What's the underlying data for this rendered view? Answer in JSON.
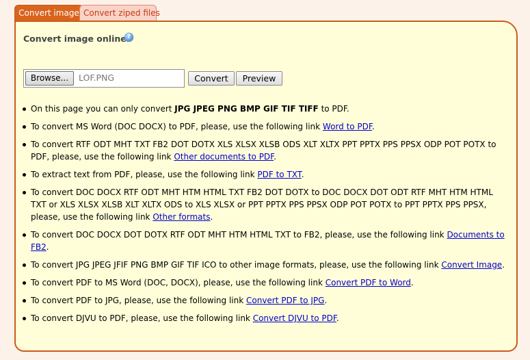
{
  "tabs": [
    {
      "label": "Convert image",
      "active": true
    },
    {
      "label": "Convert ziped files",
      "active": false
    }
  ],
  "panel": {
    "heading": "Convert image online:",
    "help_icon": "question-icon",
    "browse_label": "Browse...",
    "file_name": "LOF.PNG",
    "convert_label": "Convert",
    "preview_label": "Preview"
  },
  "info": [
    {
      "pre": "On this page you can only convert ",
      "bold": "JPG JPEG PNG BMP GIF TIF TIFF",
      "post": " to PDF."
    },
    {
      "pre": "To convert MS Word (DOC DOCX) to PDF, please, use the following link ",
      "link": "Word to PDF",
      "post": "."
    },
    {
      "pre": "To convert RTF ODT MHT TXT FB2 DOT DOTX XLS XLSX XLSB ODS XLT XLTX PPT PPTX PPS PPSX ODP POT POTX to PDF, please, use the following link ",
      "link": "Other documents to PDF",
      "post": "."
    },
    {
      "pre": "To extract text from PDF, please, use the following link ",
      "link": "PDF to TXT",
      "post": "."
    },
    {
      "pre": "To convert DOC DOCX RTF ODT MHT HTM HTML TXT FB2 DOT DOTX to DOC DOCX DOT ODT RTF MHT HTM HTML TXT or XLS XLSX XLSB XLT XLTX ODS to XLS XLSX or PPT PPTX PPS PPSX ODP POT POTX to PPT PPTX PPS PPSX, please, use the following link ",
      "link": "Other formats",
      "post": "."
    },
    {
      "pre": "To convert DOC DOCX DOT DOTX RTF ODT MHT HTM HTML TXT to FB2, please, use the following link ",
      "link": "Documents to FB2",
      "post": "."
    },
    {
      "pre": "To convert JPG JPEG JFIF PNG BMP GIF TIF ICO to other image formats, please, use the following link ",
      "link": "Convert Image",
      "post": "."
    },
    {
      "pre": "To convert PDF to MS Word (DOC, DOCX), please, use the following link ",
      "link": "Convert PDF to Word",
      "post": "."
    },
    {
      "pre": "To convert PDF to JPG, please, use the following link ",
      "link": "Convert PDF to JPG",
      "post": "."
    },
    {
      "pre": "To convert DJVU to PDF, please, use the following link ",
      "link": "Convert DJVU to PDF",
      "post": "."
    }
  ],
  "colors": {
    "accent": "#d9641e",
    "panel_bg": "#fffed9",
    "inactive_tab_bg": "#f8d3c8",
    "link": "#0000cc"
  }
}
